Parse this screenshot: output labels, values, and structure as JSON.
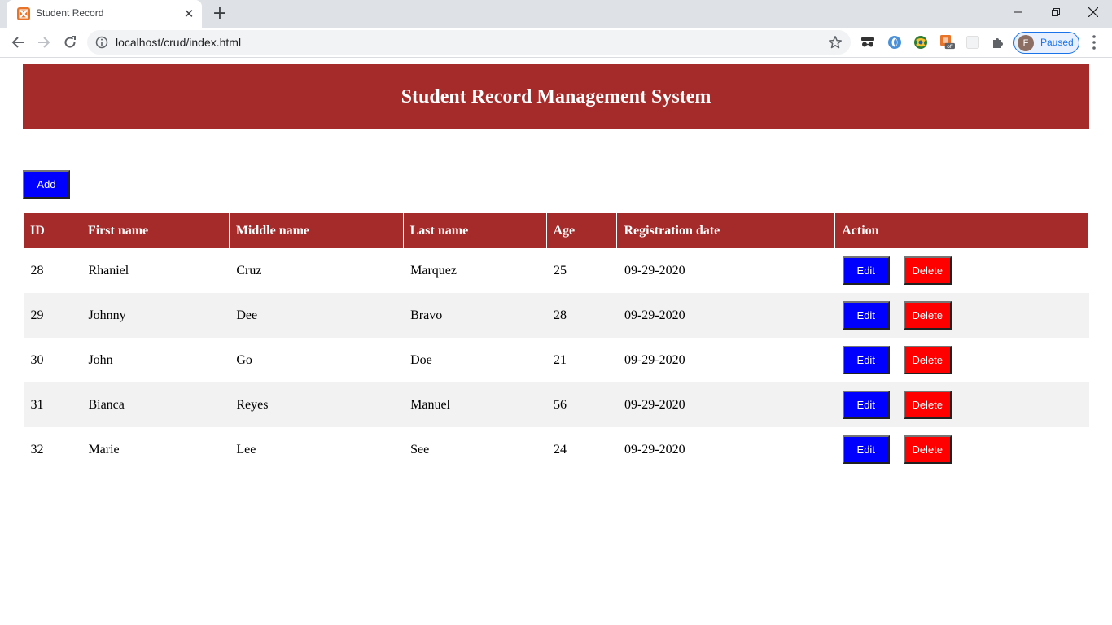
{
  "browser": {
    "tab_title": "Student Record",
    "tab_favicon": "xampp-icon",
    "url": "localhost/crud/index.html",
    "profile_initial": "F",
    "profile_status": "Paused",
    "extension_badge": "off"
  },
  "page": {
    "title": "Student Record Management System",
    "add_label": "Add",
    "colors": {
      "header": "#a52a2a",
      "primary": "#0000ff",
      "danger": "#ff0000",
      "stripe": "#f2f2f2"
    }
  },
  "table": {
    "headers": [
      "ID",
      "First name",
      "Middle name",
      "Last name",
      "Age",
      "Registration date",
      "Action"
    ],
    "edit_label": "Edit",
    "delete_label": "Delete",
    "rows": [
      {
        "id": "28",
        "first": "Rhaniel",
        "middle": "Cruz",
        "last": "Marquez",
        "age": "25",
        "reg": "09-29-2020"
      },
      {
        "id": "29",
        "first": "Johnny",
        "middle": "Dee",
        "last": "Bravo",
        "age": "28",
        "reg": "09-29-2020"
      },
      {
        "id": "30",
        "first": "John",
        "middle": "Go",
        "last": "Doe",
        "age": "21",
        "reg": "09-29-2020"
      },
      {
        "id": "31",
        "first": "Bianca",
        "middle": "Reyes",
        "last": "Manuel",
        "age": "56",
        "reg": "09-29-2020"
      },
      {
        "id": "32",
        "first": "Marie",
        "middle": "Lee",
        "last": "See",
        "age": "24",
        "reg": "09-29-2020"
      }
    ]
  }
}
